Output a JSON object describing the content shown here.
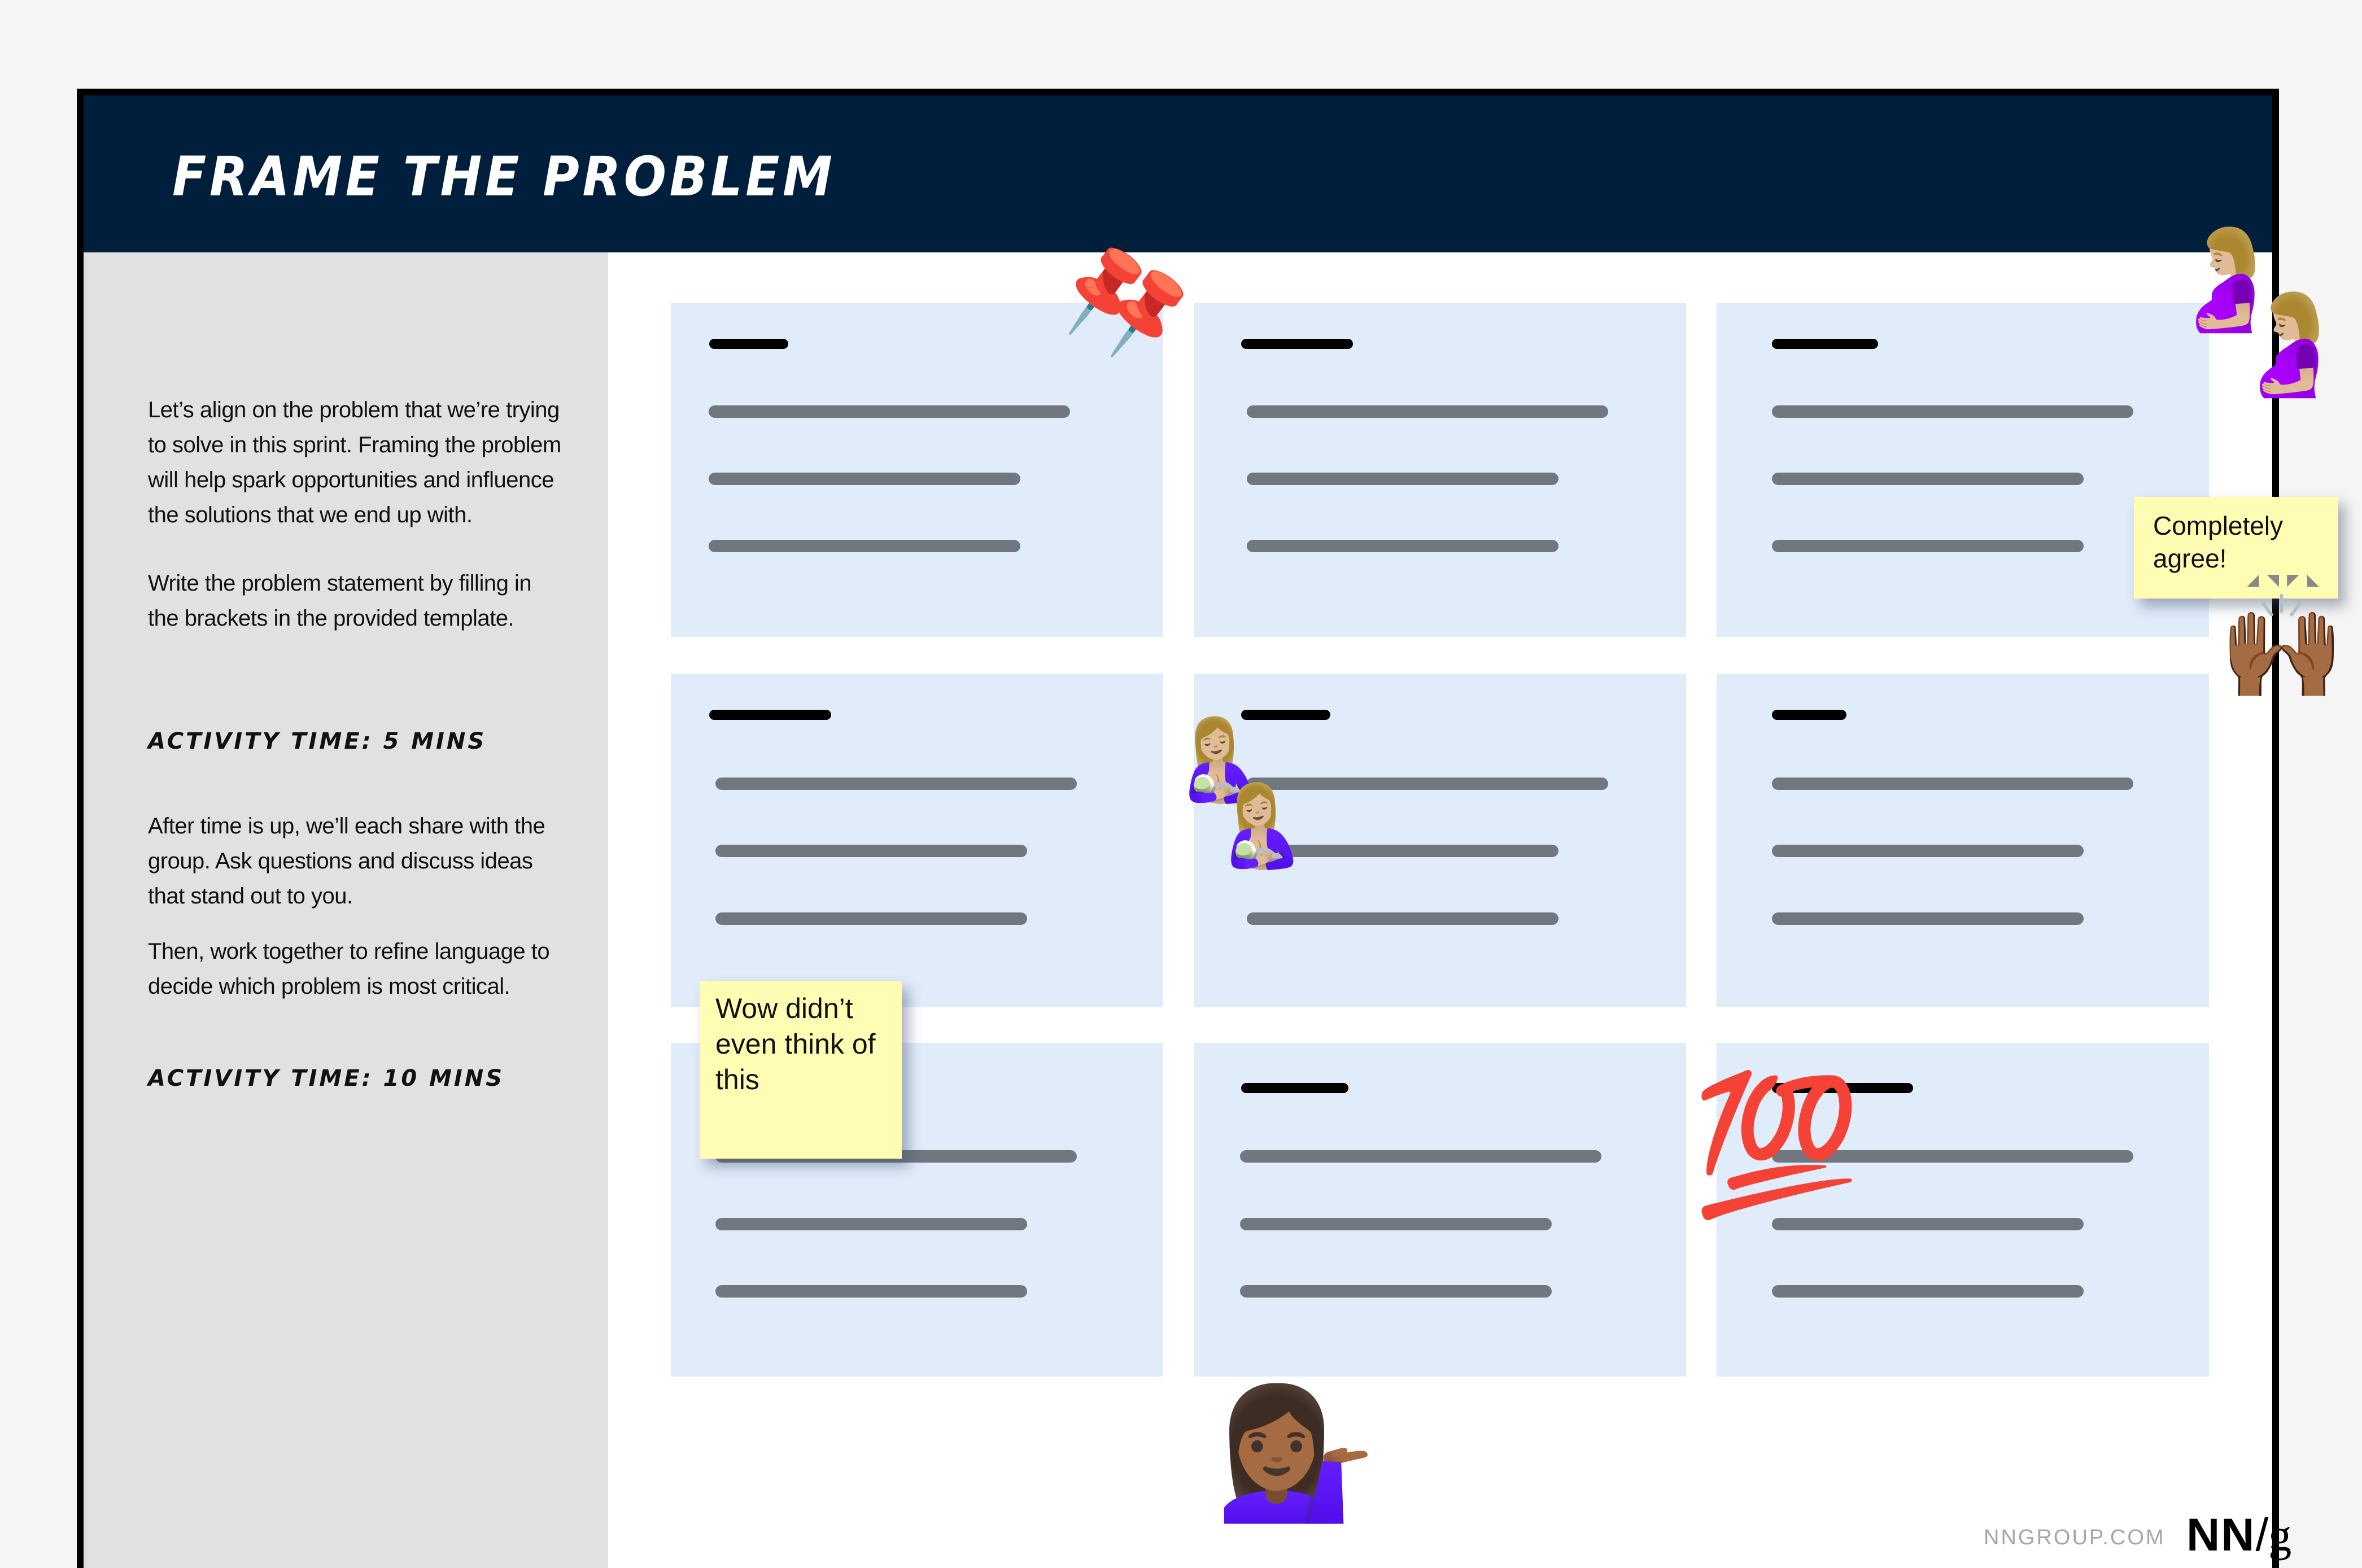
{
  "header": {
    "title": "Frame the Problem"
  },
  "sidebar": {
    "paragraphs": [
      "Let’s align on the problem that we’re trying to solve in this sprint. Framing the problem will help spark opportunities and influence the solutions that we end up with.",
      "Write the problem statement by filling in the brackets in the provided template.",
      "After time is up, we’ll each share with the group. Ask questions and discuss ideas that stand out to you.",
      "Then, work together to refine language to decide which problem is most critical."
    ],
    "activity_times": [
      "Activity time: 5 mins",
      "Activity time: 10 mins"
    ]
  },
  "board": {
    "cards": [
      {
        "row": 1,
        "col": 1
      },
      {
        "row": 1,
        "col": 2
      },
      {
        "row": 1,
        "col": 3
      },
      {
        "row": 2,
        "col": 1
      },
      {
        "row": 2,
        "col": 2
      },
      {
        "row": 2,
        "col": 3
      },
      {
        "row": 3,
        "col": 1
      },
      {
        "row": 3,
        "col": 2
      },
      {
        "row": 3,
        "col": 3
      }
    ],
    "stickies": [
      {
        "text": "Completely agree!"
      },
      {
        "text": "Wow didn’t even think of this"
      }
    ],
    "reactions": [
      {
        "name": "pushpin",
        "glyph": "📌",
        "count": 2
      },
      {
        "name": "pregnant-woman",
        "glyph": "🤰🏼",
        "count": 2
      },
      {
        "name": "raising-hands",
        "glyph": "🙌🏾",
        "count": 1
      },
      {
        "name": "breastfeeding",
        "glyph": "🤱🏼",
        "count": 2
      },
      {
        "name": "hundred-points",
        "glyph": "💯",
        "count": 1
      },
      {
        "name": "woman-tipping-hand",
        "glyph": "💁🏾‍♀️",
        "count": 1
      }
    ]
  },
  "footer": {
    "url": "NNGROUP.COM",
    "logo_nn": "NN",
    "logo_slash": "/",
    "logo_g": "g"
  },
  "colors": {
    "header_bg": "#001f3d",
    "sidebar_bg": "#e1e1e1",
    "card_bg": "#e0ecfa",
    "placeholder_line": "#70777f",
    "sticky_bg": "#fffdb3"
  }
}
